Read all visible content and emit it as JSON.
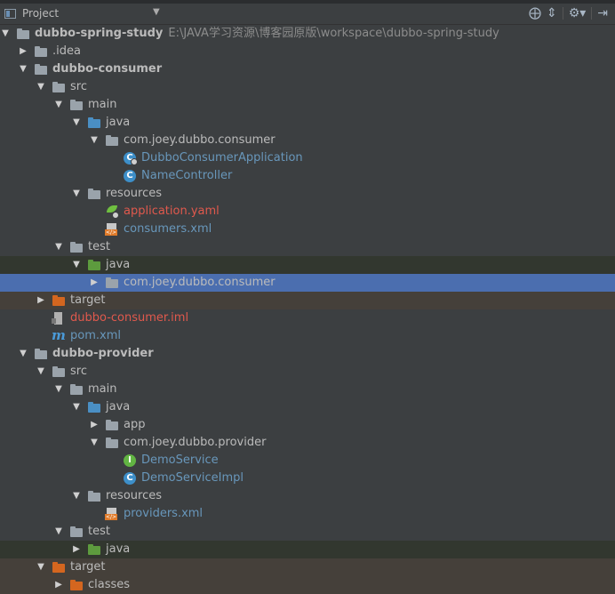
{
  "header": {
    "title": "Project",
    "icons": [
      "target-icon",
      "collapse-icon",
      "gear-icon",
      "hide-icon"
    ]
  },
  "tree": [
    {
      "id": "r0",
      "depth": 0,
      "arrow": "down",
      "icon": "module",
      "label": "dubbo-spring-study",
      "bold": true,
      "path": "E:\\JAVA学习资源\\博客园原版\\workspace\\dubbo-spring-study"
    },
    {
      "id": "r1",
      "depth": 1,
      "arrow": "right",
      "icon": "folder-grey",
      "label": ".idea"
    },
    {
      "id": "r2",
      "depth": 1,
      "arrow": "down",
      "icon": "module",
      "label": "dubbo-consumer",
      "bold": true
    },
    {
      "id": "r3",
      "depth": 2,
      "arrow": "down",
      "icon": "folder-grey",
      "label": "src"
    },
    {
      "id": "r4",
      "depth": 3,
      "arrow": "down",
      "icon": "folder-grey",
      "label": "main"
    },
    {
      "id": "r5",
      "depth": 4,
      "arrow": "down",
      "icon": "folder-blue",
      "label": "java"
    },
    {
      "id": "r6",
      "depth": 5,
      "arrow": "down",
      "icon": "package",
      "label": "com.joey.dubbo.consumer"
    },
    {
      "id": "r7",
      "depth": 6,
      "arrow": "none",
      "icon": "spring-class",
      "label": "DubboConsumerApplication",
      "color": "class"
    },
    {
      "id": "r8",
      "depth": 6,
      "arrow": "none",
      "icon": "class",
      "label": "NameController",
      "color": "class"
    },
    {
      "id": "r9",
      "depth": 4,
      "arrow": "down",
      "icon": "folder-resources",
      "label": "resources"
    },
    {
      "id": "r10",
      "depth": 5,
      "arrow": "none",
      "icon": "yaml",
      "label": "application.yaml",
      "color": "red"
    },
    {
      "id": "r11",
      "depth": 5,
      "arrow": "none",
      "icon": "xml",
      "label": "consumers.xml",
      "color": "class"
    },
    {
      "id": "r12",
      "depth": 3,
      "arrow": "down",
      "icon": "folder-grey",
      "label": "test"
    },
    {
      "id": "r13",
      "depth": 4,
      "arrow": "down",
      "icon": "folder-green",
      "label": "java",
      "bg": "test"
    },
    {
      "id": "r14",
      "depth": 5,
      "arrow": "right",
      "icon": "package",
      "label": "com.joey.dubbo.consumer",
      "bg": "selected"
    },
    {
      "id": "r15",
      "depth": 2,
      "arrow": "right",
      "icon": "folder-orange",
      "label": "target",
      "bg": "excluded"
    },
    {
      "id": "r16",
      "depth": 2,
      "arrow": "none",
      "icon": "iml",
      "label": "dubbo-consumer.iml",
      "color": "red"
    },
    {
      "id": "r17",
      "depth": 2,
      "arrow": "none",
      "icon": "maven",
      "label": "pom.xml",
      "color": "class"
    },
    {
      "id": "r18",
      "depth": 1,
      "arrow": "down",
      "icon": "module",
      "label": "dubbo-provider",
      "bold": true
    },
    {
      "id": "r19",
      "depth": 2,
      "arrow": "down",
      "icon": "folder-grey",
      "label": "src"
    },
    {
      "id": "r20",
      "depth": 3,
      "arrow": "down",
      "icon": "folder-grey",
      "label": "main"
    },
    {
      "id": "r21",
      "depth": 4,
      "arrow": "down",
      "icon": "folder-blue",
      "label": "java"
    },
    {
      "id": "r22",
      "depth": 5,
      "arrow": "right",
      "icon": "package",
      "label": "app"
    },
    {
      "id": "r23",
      "depth": 5,
      "arrow": "down",
      "icon": "package",
      "label": "com.joey.dubbo.provider"
    },
    {
      "id": "r24",
      "depth": 6,
      "arrow": "none",
      "icon": "interface",
      "label": "DemoService",
      "color": "class"
    },
    {
      "id": "r25",
      "depth": 6,
      "arrow": "none",
      "icon": "class",
      "label": "DemoServiceImpl",
      "color": "class"
    },
    {
      "id": "r26",
      "depth": 4,
      "arrow": "down",
      "icon": "folder-resources",
      "label": "resources"
    },
    {
      "id": "r27",
      "depth": 5,
      "arrow": "none",
      "icon": "xml",
      "label": "providers.xml",
      "color": "class"
    },
    {
      "id": "r28",
      "depth": 3,
      "arrow": "down",
      "icon": "folder-grey",
      "label": "test"
    },
    {
      "id": "r29",
      "depth": 4,
      "arrow": "right",
      "icon": "folder-green",
      "label": "java",
      "bg": "test"
    },
    {
      "id": "r30",
      "depth": 2,
      "arrow": "down",
      "icon": "folder-orange",
      "label": "target",
      "bg": "excluded"
    },
    {
      "id": "r31",
      "depth": 3,
      "arrow": "right",
      "icon": "folder-orange",
      "label": "classes",
      "bg": "excluded"
    }
  ],
  "colors": {
    "background": "#3c3f41",
    "selection": "#4b6eaf",
    "class_text": "#6897bb",
    "unversioned_text": "#e0594d"
  }
}
